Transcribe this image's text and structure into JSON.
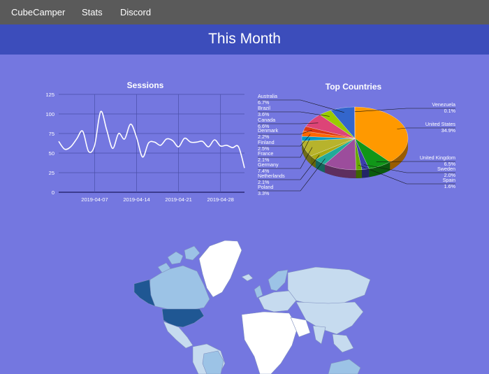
{
  "navbar": {
    "brand": "CubeCamper",
    "links": [
      {
        "label": "Stats"
      },
      {
        "label": "Discord"
      }
    ]
  },
  "banner": {
    "title": "This Month"
  },
  "chart_data": [
    {
      "type": "line",
      "title": "Sessions",
      "x_ticks": [
        "2019-04-07",
        "2019-04-14",
        "2019-04-21",
        "2019-04-28"
      ],
      "x": [
        "2019-04-01",
        "2019-04-02",
        "2019-04-03",
        "2019-04-04",
        "2019-04-05",
        "2019-04-06",
        "2019-04-07",
        "2019-04-08",
        "2019-04-09",
        "2019-04-10",
        "2019-04-11",
        "2019-04-12",
        "2019-04-13",
        "2019-04-14",
        "2019-04-15",
        "2019-04-16",
        "2019-04-17",
        "2019-04-18",
        "2019-04-19",
        "2019-04-20",
        "2019-04-21",
        "2019-04-22",
        "2019-04-23",
        "2019-04-24",
        "2019-04-25",
        "2019-04-26",
        "2019-04-27",
        "2019-04-28",
        "2019-04-29",
        "2019-04-30",
        "2019-05-01",
        "2019-05-02"
      ],
      "y": [
        65,
        55,
        58,
        68,
        78,
        52,
        60,
        103,
        80,
        56,
        75,
        68,
        87,
        70,
        45,
        63,
        64,
        60,
        68,
        66,
        58,
        69,
        64,
        64,
        65,
        58,
        67,
        59,
        60,
        57,
        58,
        31
      ],
      "ylim": [
        0,
        125
      ],
      "y_ticks": [
        0,
        25,
        50,
        75,
        100,
        125
      ],
      "color": "#ffffff"
    },
    {
      "type": "pie",
      "title": "Top Countries",
      "slices": [
        {
          "label": "United States",
          "value": 34.9,
          "pct": "34.9%",
          "color": "#ff9900",
          "shown": true
        },
        {
          "label": "United Kingdom",
          "value": 6.5,
          "pct": "6.5%",
          "color": "#109618",
          "shown": true
        },
        {
          "label": "Sweden",
          "value": 2.0,
          "pct": "2.0%",
          "color": "#3b3eac",
          "shown": true
        },
        {
          "label": "Spain",
          "value": 1.6,
          "pct": "1.6%",
          "color": "#66aa00",
          "shown": true
        },
        {
          "label": "",
          "value": 9.0,
          "pct": "",
          "color": "#9c4d9c",
          "shown": false
        },
        {
          "label": "Poland",
          "value": 3.3,
          "pct": "3.3%",
          "color": "#22aa99",
          "shown": true
        },
        {
          "label": "Netherlands",
          "value": 2.1,
          "pct": "2.1%",
          "color": "#aaaa11",
          "shown": true
        },
        {
          "label": "Germany",
          "value": 7.4,
          "pct": "7.4%",
          "color": "#b7b32c",
          "shown": true
        },
        {
          "label": "France",
          "value": 2.1,
          "pct": "2.1%",
          "color": "#0099c6",
          "shown": true
        },
        {
          "label": "Finland",
          "value": 2.5,
          "pct": "2.5%",
          "color": "#ff6600",
          "shown": true
        },
        {
          "label": "Denmark",
          "value": 2.2,
          "pct": "2.2%",
          "color": "#dc3912",
          "shown": true
        },
        {
          "label": "Canada",
          "value": 6.6,
          "pct": "6.6%",
          "color": "#dd4477",
          "shown": true
        },
        {
          "label": "Brazil",
          "value": 3.6,
          "pct": "3.6%",
          "color": "#9aca00",
          "shown": true
        },
        {
          "label": "Australia",
          "value": 6.7,
          "pct": "6.7%",
          "color": "#3366cc",
          "shown": true
        },
        {
          "label": "Venezuela",
          "value": 0.1,
          "pct": "0.1%",
          "color": "#990099",
          "shown": true
        }
      ]
    },
    {
      "type": "map",
      "colors": {
        "high": "#1f5793",
        "mid": "#9cc3e6",
        "low": "#c6dbef",
        "none": "#ffffff"
      }
    }
  ]
}
